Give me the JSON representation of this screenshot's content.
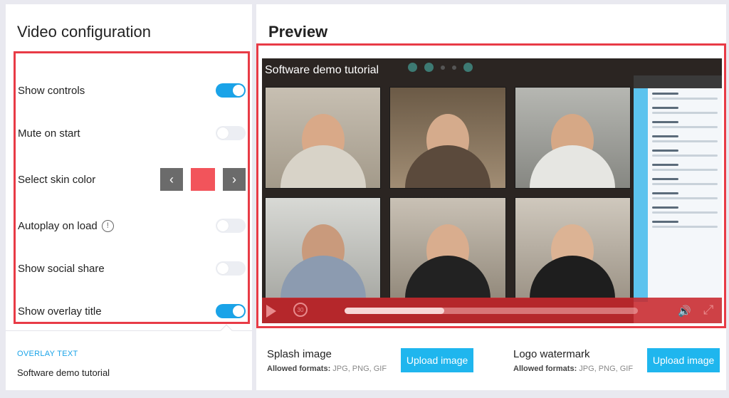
{
  "config": {
    "title": "Video configuration",
    "settings": [
      {
        "label": "Show controls",
        "on": true
      },
      {
        "label": "Mute on start",
        "on": false
      },
      {
        "label": "Select skin color"
      },
      {
        "label": "Autoplay on load",
        "on": false
      },
      {
        "label": "Show social share",
        "on": false
      },
      {
        "label": "Show overlay title",
        "on": true
      }
    ],
    "info_glyph": "!",
    "prev_glyph": "‹",
    "next_glyph": "›",
    "skin_color": "#f2545b",
    "overlay_label": "OVERLAY TEXT",
    "overlay_value": "Software demo tutorial"
  },
  "preview": {
    "title": "Preview",
    "video_title": "Software demo tutorial",
    "replay_label": "30",
    "progress": 0.34,
    "accent": "#1aa3e8"
  },
  "uploads": {
    "splash": {
      "title": "Splash image",
      "formats_label": "Allowed formats:",
      "formats": "JPG, PNG, GIF",
      "button": "Upload image"
    },
    "logo": {
      "title": "Logo watermark",
      "formats_label": "Allowed formats:",
      "formats": "JPG, PNG, GIF",
      "button": "Upload image"
    }
  }
}
